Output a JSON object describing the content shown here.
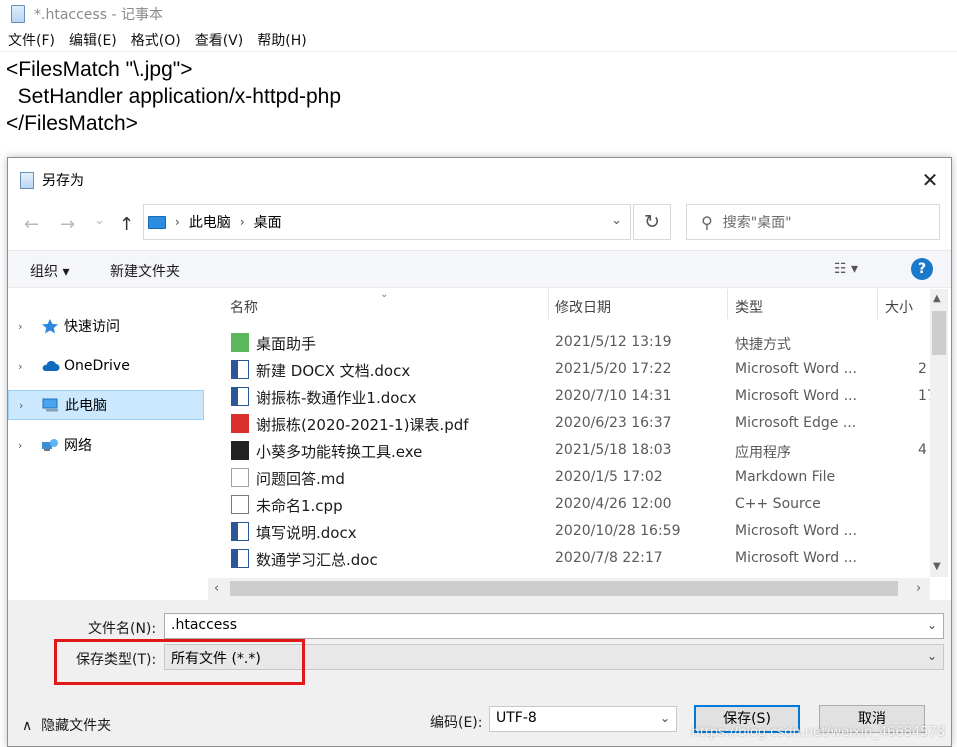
{
  "notepad": {
    "title": "*.htaccess - 记事本",
    "menu": [
      "文件(F)",
      "编辑(E)",
      "格式(O)",
      "查看(V)",
      "帮助(H)"
    ],
    "content": "<FilesMatch \"\\.jpg\">\n  SetHandler application/x-httpd-php\n</FilesMatch>"
  },
  "dialog": {
    "title": "另存为",
    "close_glyph": "✕",
    "nav_glyphs": {
      "back": "←",
      "forward": "→",
      "recent": "⌄",
      "up": "↑",
      "refresh": "↻",
      "chevron": "›"
    },
    "breadcrumb": [
      "此电脑",
      "桌面"
    ],
    "search_placeholder": "搜索\"桌面\"",
    "toolbar": {
      "organize": "组织 ▾",
      "new_folder": "新建文件夹",
      "view": "☷ ▾",
      "help": "?"
    },
    "nav_pane": [
      {
        "label": "快速访问",
        "icon": "star-icon",
        "selected": false
      },
      {
        "label": "OneDrive",
        "icon": "cloud-icon",
        "selected": false
      },
      {
        "label": "此电脑",
        "icon": "computer-icon",
        "selected": true
      },
      {
        "label": "网络",
        "icon": "network-icon",
        "selected": false
      }
    ],
    "columns": [
      "名称",
      "修改日期",
      "类型",
      "大小"
    ],
    "files": [
      {
        "name": "桌面助手",
        "date": "2021/5/12 13:19",
        "type": "快捷方式",
        "size": "",
        "icon": "shortcut-icon",
        "color": "#5cb85c"
      },
      {
        "name": "新建 DOCX 文档.docx",
        "date": "2021/5/20 17:22",
        "type": "Microsoft Word ...",
        "size": "2",
        "icon": "word-icon",
        "color": "#2b579a"
      },
      {
        "name": "谢振栋-数通作业1.docx",
        "date": "2020/7/10 14:31",
        "type": "Microsoft Word ...",
        "size": "17",
        "icon": "word-icon",
        "color": "#2b579a"
      },
      {
        "name": "谢振栋(2020-2021-1)课表.pdf",
        "date": "2020/6/23 16:37",
        "type": "Microsoft Edge ...",
        "size": "",
        "icon": "pdf-icon",
        "color": "#d9302c"
      },
      {
        "name": "小葵多功能转换工具.exe",
        "date": "2021/5/18 18:03",
        "type": "应用程序",
        "size": "4",
        "icon": "exe-icon",
        "color": "#222222"
      },
      {
        "name": "问题回答.md",
        "date": "2020/1/5 17:02",
        "type": "Markdown File",
        "size": "",
        "icon": "markdown-icon",
        "color": "#9aa0a6"
      },
      {
        "name": "未命名1.cpp",
        "date": "2020/4/26 12:00",
        "type": "C++ Source",
        "size": "",
        "icon": "cpp-icon",
        "color": "#7a7a7a"
      },
      {
        "name": "填写说明.docx",
        "date": "2020/10/28 16:59",
        "type": "Microsoft Word ...",
        "size": "",
        "icon": "word-icon",
        "color": "#2b579a"
      },
      {
        "name": "数通学习汇总.doc",
        "date": "2020/7/8 22:17",
        "type": "Microsoft Word ...",
        "size": "",
        "icon": "word-icon",
        "color": "#2b579a"
      }
    ],
    "form": {
      "filename_label": "文件名(N):",
      "filename_value": ".htaccess",
      "filetype_label": "保存类型(T):",
      "filetype_value": "所有文件  (*.*)",
      "encoding_label": "编码(E):",
      "encoding_value": "UTF-8",
      "hide_folders": "隐藏文件夹",
      "save": "保存(S)",
      "cancel": "取消",
      "dropdown_glyph": "⌄",
      "toggle_glyph": "∧"
    },
    "highlight_color": "#e01818",
    "accent_color": "#0078d7",
    "watermark": "https://blog.csdn.net/weixin_46684578"
  }
}
